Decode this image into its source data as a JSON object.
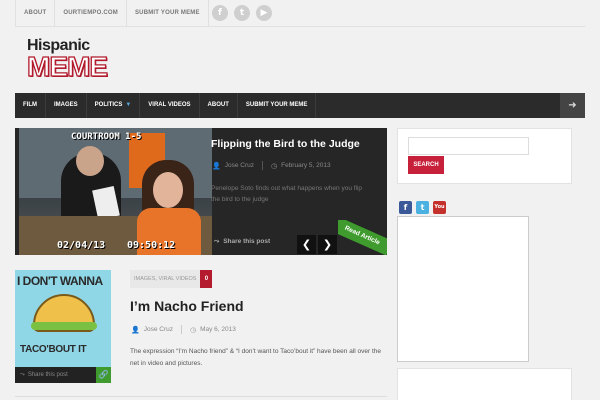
{
  "topbar": {
    "links": [
      "ABOUT",
      "OURTIEMPO.COM",
      "SUBMIT YOUR MEME"
    ],
    "social": [
      {
        "icon": "facebook-icon",
        "glyph": "f"
      },
      {
        "icon": "twitter-icon",
        "glyph": "t"
      },
      {
        "icon": "youtube-icon",
        "glyph": "▶"
      }
    ]
  },
  "logo": {
    "line1": "Hispanic",
    "line2": "MEME",
    "color": "#b11a2c"
  },
  "nav": {
    "items": [
      "FILM",
      "IMAGES",
      "POLITICS",
      "VIRAL VIDEOS",
      "ABOUT",
      "SUBMIT YOUR MEME"
    ],
    "login_icon": "login-icon"
  },
  "slider": {
    "image_caption_top": "COURTROOM 1-5",
    "image_caption_date": "02/04/13",
    "image_caption_time": "09:50:12",
    "title": "Flipping the Bird to the Judge",
    "author": "Jose Cruz",
    "date": "February 5, 2013",
    "excerpt": "Penelope Soto finds out what happens when you flip the bird to the judge",
    "share_label": "Share this post",
    "read_label": "Read Article",
    "prev": "❮",
    "next": "❯"
  },
  "article": {
    "image_text_top": "I DON'T WANNA",
    "image_text_bottom": "TACO'BOUT IT",
    "categories": "IMAGES, VIRAL VIDEOS",
    "comment_count": "0",
    "title": "I’m Nacho Friend",
    "author": "Jose Cruz",
    "date": "May 6, 2013",
    "excerpt": "The expression “I’m Nacho friend” & “I don’t want to Taco’bout it” have been all over the net in video and pictures.",
    "share_label": "Share this post",
    "link_glyph": "🔗"
  },
  "sidebar": {
    "search_placeholder": "",
    "search_button": "SEARCH",
    "icons": [
      {
        "icon": "facebook-icon",
        "glyph": "f"
      },
      {
        "icon": "twitter-icon",
        "glyph": "t"
      },
      {
        "icon": "youtube-icon",
        "glyph": "You"
      }
    ]
  },
  "colors": {
    "accent": "#c7203a",
    "nav_bg": "#2b2b2b",
    "green": "#3f9b2d"
  }
}
